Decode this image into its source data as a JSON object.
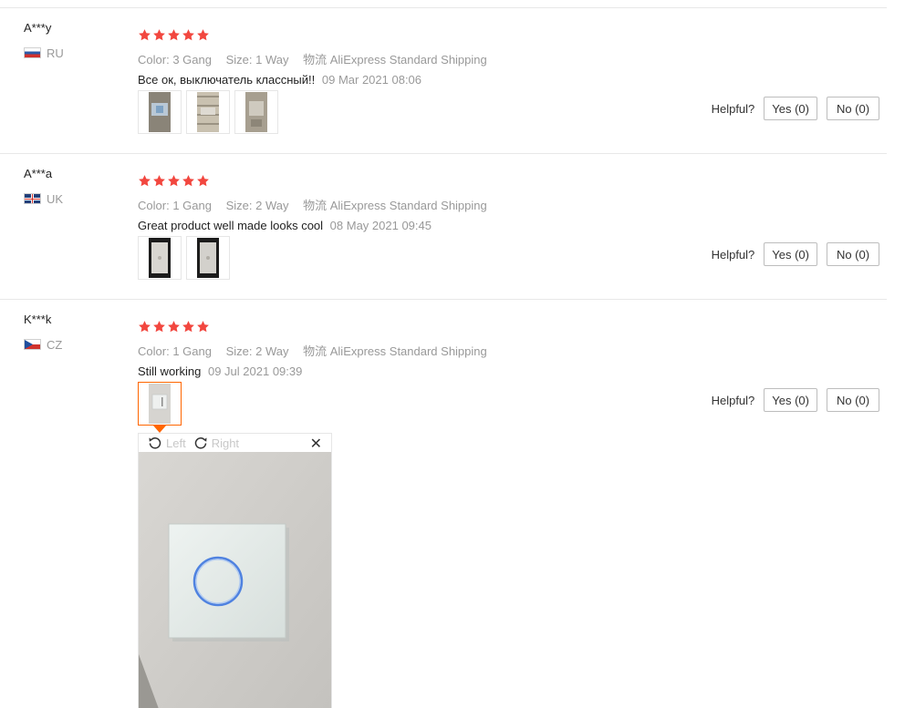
{
  "reviews": [
    {
      "user": "A***y",
      "country": "RU",
      "flag": "ru-flag-icon",
      "stars": 5,
      "color_label": "Color:",
      "color_value": "3 Gang",
      "size_label": "Size:",
      "size_value": "1 Way",
      "shipping_label": "物流",
      "shipping_value": "AliExpress Standard Shipping",
      "comment": "Все ок, выключатель классный!!",
      "date": "09 Mar 2021 08:06",
      "photo_count": 3,
      "helpful_label": "Helpful?",
      "yes_label": "Yes (0)",
      "no_label": "No (0)"
    },
    {
      "user": "A***a",
      "country": "UK",
      "flag": "uk-flag-icon",
      "stars": 5,
      "color_label": "Color:",
      "color_value": "1 Gang",
      "size_label": "Size:",
      "size_value": "2 Way",
      "shipping_label": "物流",
      "shipping_value": "AliExpress Standard Shipping",
      "comment": "Great product well made looks cool",
      "date": "08 May 2021 09:45",
      "photo_count": 2,
      "helpful_label": "Helpful?",
      "yes_label": "Yes (0)",
      "no_label": "No (0)"
    },
    {
      "user": "K***k",
      "country": "CZ",
      "flag": "cz-flag-icon",
      "stars": 5,
      "color_label": "Color:",
      "color_value": "1 Gang",
      "size_label": "Size:",
      "size_value": "2 Way",
      "shipping_label": "物流",
      "shipping_value": "AliExpress Standard Shipping",
      "comment": "Still working",
      "date": "09 Jul 2021 09:39",
      "photo_count": 1,
      "helpful_label": "Helpful?",
      "yes_label": "Yes (0)",
      "no_label": "No (0)"
    }
  ],
  "viewer": {
    "rotate_left": "Left",
    "rotate_right": "Right",
    "close_icon": "close-icon",
    "rotate_left_icon": "rotate-left-icon",
    "rotate_right_icon": "rotate-right-icon"
  },
  "colors": {
    "star": "#f2473f",
    "accent": "#ff6600",
    "muted": "#999999"
  }
}
